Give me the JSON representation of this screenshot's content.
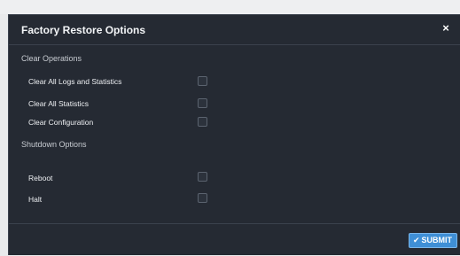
{
  "dialog": {
    "title": "Factory Restore Options",
    "close_glyph": "×",
    "close_icon": "close-icon"
  },
  "clear_operations": {
    "title": "Clear Operations",
    "options": [
      {
        "label": "Clear All Logs and Statistics",
        "checked": false
      },
      {
        "label": "Clear All Statistics",
        "checked": false
      },
      {
        "label": "Clear Configuration",
        "checked": false
      }
    ]
  },
  "shutdown_options": {
    "title": "Shutdown Options",
    "options": [
      {
        "label": "Reboot",
        "checked": false
      },
      {
        "label": "Halt",
        "checked": false
      }
    ]
  },
  "footer": {
    "submit_label": "SUBMIT",
    "submit_icon": "check-icon",
    "submit_glyph": "✔"
  },
  "colors": {
    "dialog_bg": "#252a33",
    "accent": "#3f8fd6"
  }
}
